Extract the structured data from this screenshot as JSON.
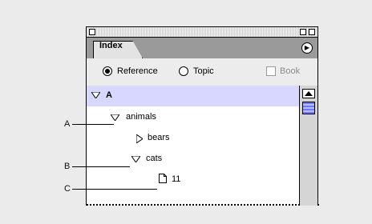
{
  "panel": {
    "tab_label": "Index",
    "options": {
      "reference_label": "Reference",
      "topic_label": "Topic",
      "book_label": "Book",
      "selected": "Reference"
    }
  },
  "list": {
    "items": [
      {
        "label": "A",
        "kind": "group-expanded",
        "selected": true
      },
      {
        "label": "animals",
        "kind": "group-expanded",
        "selected": false
      },
      {
        "label": "bears",
        "kind": "group-collapsed",
        "selected": false
      },
      {
        "label": "cats",
        "kind": "group-expanded",
        "selected": false
      },
      {
        "label": "11",
        "kind": "page-reference",
        "selected": false
      }
    ]
  },
  "callouts": {
    "a": "A",
    "b": "B",
    "c": "C"
  },
  "colors": {
    "selection": "#d7d7ff",
    "scroll_thumb": "#6d78ff",
    "background": "#ebebeb"
  }
}
